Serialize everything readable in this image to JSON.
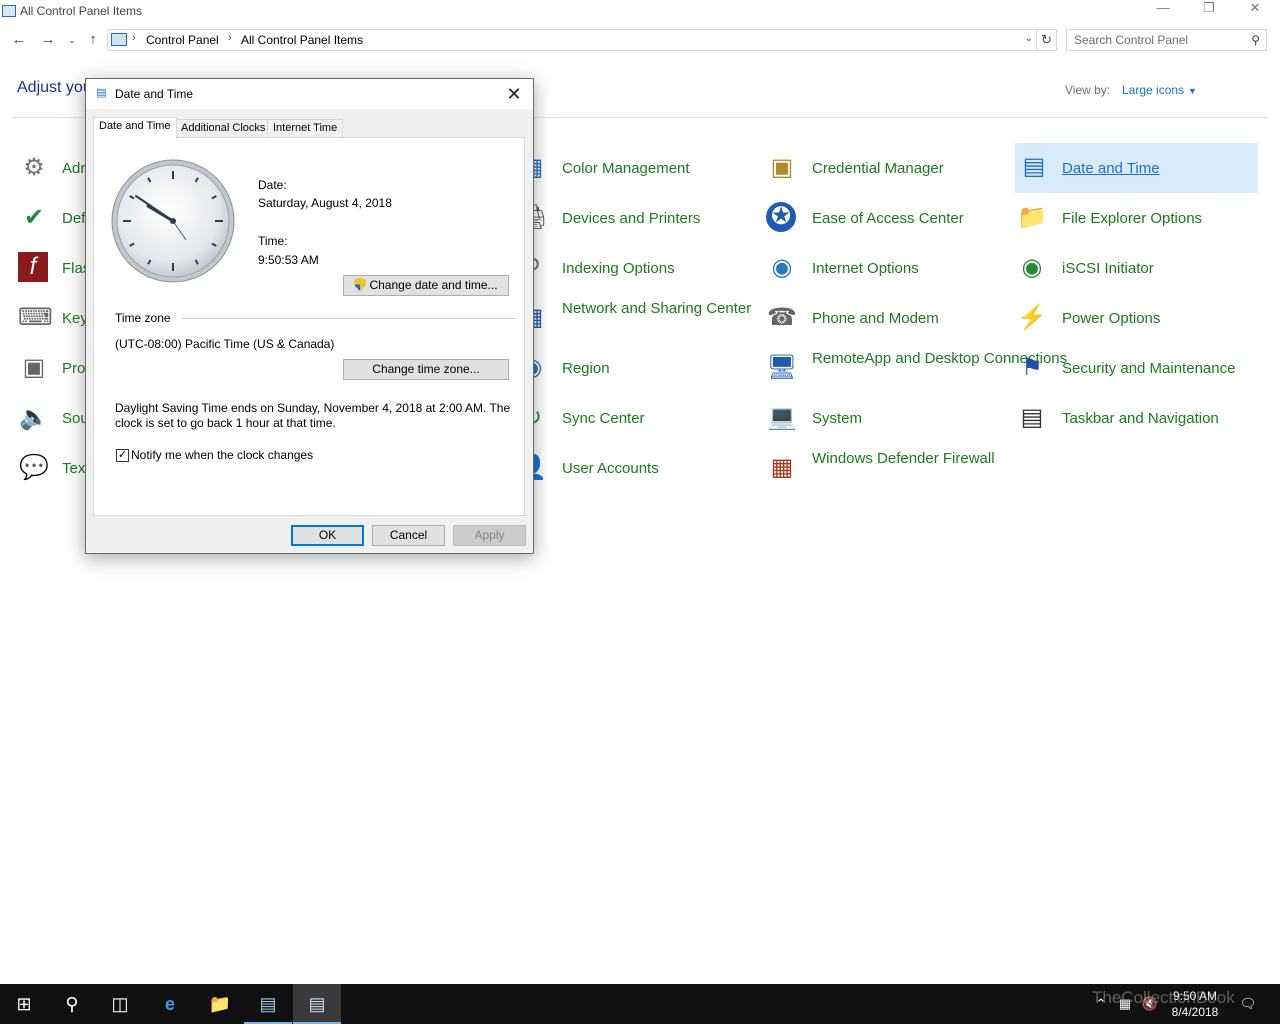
{
  "window": {
    "title": "All Control Panel Items"
  },
  "nav": {
    "breadcrumb": [
      "Control Panel",
      "All Control Panel Items"
    ],
    "search_placeholder": "Search Control Panel"
  },
  "main": {
    "heading": "Adjust you",
    "view_by_label": "View by:",
    "view_by_value": "Large icons",
    "left_column": [
      "Adr",
      "Def",
      "Flas",
      "Key",
      "Pro",
      "Sou",
      "Text"
    ],
    "column2": [
      "Color Management",
      "Devices and Printers",
      "Indexing Options",
      "Network and Sharing Center",
      "Region",
      "Sync Center",
      "User Accounts"
    ],
    "column3": [
      "Credential Manager",
      "Ease of Access Center",
      "Internet Options",
      "Phone and Modem",
      "RemoteApp and Desktop Connections",
      "System",
      "Windows Defender Firewall"
    ],
    "column4": [
      "Date and Time",
      "File Explorer Options",
      "iSCSI Initiator",
      "Power Options",
      "Security and Maintenance",
      "Taskbar and Navigation"
    ]
  },
  "dialog": {
    "title": "Date and Time",
    "tabs": [
      "Date and Time",
      "Additional Clocks",
      "Internet Time"
    ],
    "date_label": "Date:",
    "date_value": "Saturday, August 4, 2018",
    "time_label": "Time:",
    "time_value": "9:50:53 AM",
    "change_datetime_button": "Change date and time...",
    "timezone_label": "Time zone",
    "timezone_value": "(UTC-08:00) Pacific Time (US & Canada)",
    "change_timezone_button": "Change time zone...",
    "dst_line1": "Daylight Saving Time ends on Sunday, November 4, 2018 at 2:00 AM. The",
    "dst_line2": "clock is set to go back 1 hour at that time.",
    "notify_label": "Notify me when the clock changes",
    "notify_checked": true,
    "ok": "OK",
    "cancel": "Cancel",
    "apply": "Apply"
  },
  "taskbar": {
    "time": "9:50 AM",
    "date": "8/4/2018"
  },
  "watermark": "TheCollectionBook"
}
